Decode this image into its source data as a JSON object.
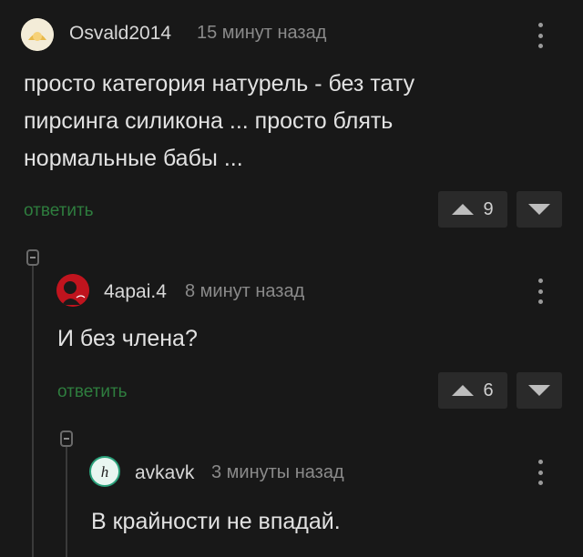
{
  "comments": [
    {
      "username": "Osvald2014",
      "time": "15 минут назад",
      "lines": [
        "просто категория натурель - без тату",
        "пирсинга силикона ... просто блять",
        "нормальные бабы ..."
      ],
      "reply_label": "ответить",
      "votes": "9"
    },
    {
      "username": "4apai.4",
      "time": "8 минут назад",
      "lines": [
        "И без члена?"
      ],
      "reply_label": "ответить",
      "votes": "6"
    },
    {
      "username": "avkavk",
      "time": "3 минуты назад",
      "lines": [
        "В крайности не впадай."
      ]
    }
  ],
  "colors": {
    "background": "#181818",
    "reply": "#2e7d3e",
    "vote_box": "#2a2a2a"
  },
  "icons": [
    "more-vertical-icon",
    "upvote-icon",
    "downvote-icon",
    "collapse-thread-icon"
  ]
}
